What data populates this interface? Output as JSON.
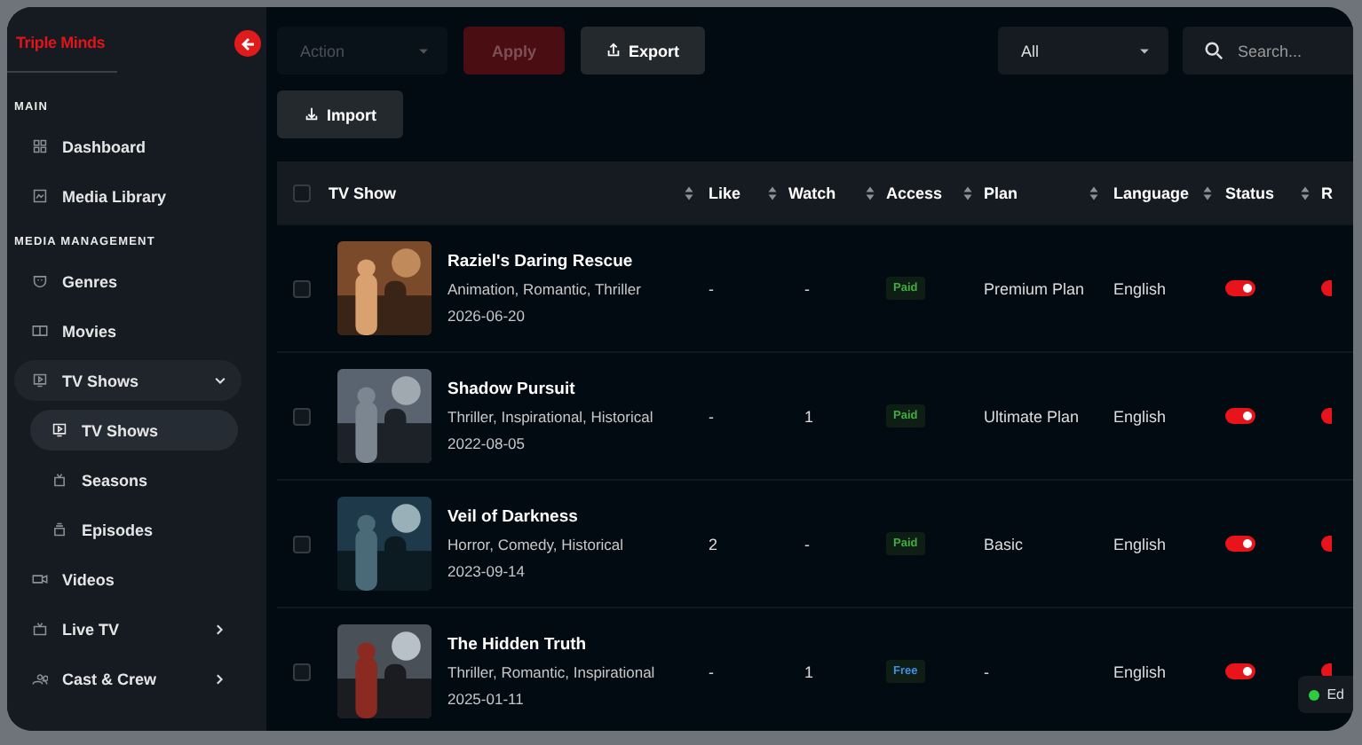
{
  "sidebar": {
    "brand": "Triple Minds",
    "sections": [
      {
        "title": "MAIN",
        "items": [
          {
            "label": "Dashboard",
            "selected": false
          },
          {
            "label": "Media Library",
            "selected": false
          }
        ]
      },
      {
        "title": "MEDIA MANAGEMENT",
        "items": [
          {
            "label": "Genres",
            "selected": false
          },
          {
            "label": "Movies",
            "selected": false
          },
          {
            "label": "TV Shows",
            "selected": false,
            "expanded": true,
            "children": [
              {
                "label": "TV Shows",
                "selected": true
              },
              {
                "label": "Seasons",
                "selected": false
              },
              {
                "label": "Episodes",
                "selected": false
              }
            ]
          },
          {
            "label": "Videos",
            "selected": false
          },
          {
            "label": "Live TV",
            "selected": false,
            "expanded": false
          },
          {
            "label": "Cast & Crew",
            "selected": false,
            "expanded": false
          }
        ]
      }
    ]
  },
  "toolbar": {
    "action": {
      "placeholder": "Action"
    },
    "apply": "Apply",
    "export": "Export",
    "import": "Import",
    "filter": {
      "value": "All"
    },
    "search": {
      "placeholder": "Search..."
    }
  },
  "table": {
    "all_checked": false,
    "columns": [
      "TV Show",
      "Like",
      "Watch",
      "Access",
      "Plan",
      "Language",
      "Status",
      "R"
    ],
    "rows": [
      {
        "checked": false,
        "title": "Raziel's Daring Rescue",
        "genres": "Animation, Romantic, Thriller",
        "date": "2026-06-20",
        "like": "-",
        "watch": "-",
        "access": {
          "label": "Paid",
          "color": "#3fae3f"
        },
        "plan": "Premium Plan",
        "language": "English",
        "on": true
      },
      {
        "checked": false,
        "title": "Shadow Pursuit",
        "genres": "Thriller, Inspirational, Historical",
        "date": "2022-08-05",
        "like": "-",
        "watch": "1",
        "access": {
          "label": "Paid",
          "color": "#3fae3f"
        },
        "plan": "Ultimate Plan",
        "language": "English",
        "on": true
      },
      {
        "checked": false,
        "title": "Veil of Darkness",
        "genres": "Horror, Comedy, Historical",
        "date": "2023-09-14",
        "like": "2",
        "watch": "-",
        "access": {
          "label": "Paid",
          "color": "#3fae3f"
        },
        "plan": "Basic",
        "language": "English",
        "on": true
      },
      {
        "checked": false,
        "title": "The Hidden Truth",
        "genres": "Thriller, Romantic, Inspirational",
        "date": "2025-01-11",
        "like": "-",
        "watch": "1",
        "access": {
          "label": "Free",
          "color": "#3b8ee8"
        },
        "plan": "-",
        "language": "English",
        "on": true
      }
    ]
  },
  "status_badge": {
    "text": "Ed",
    "color": "#2ecc40"
  }
}
